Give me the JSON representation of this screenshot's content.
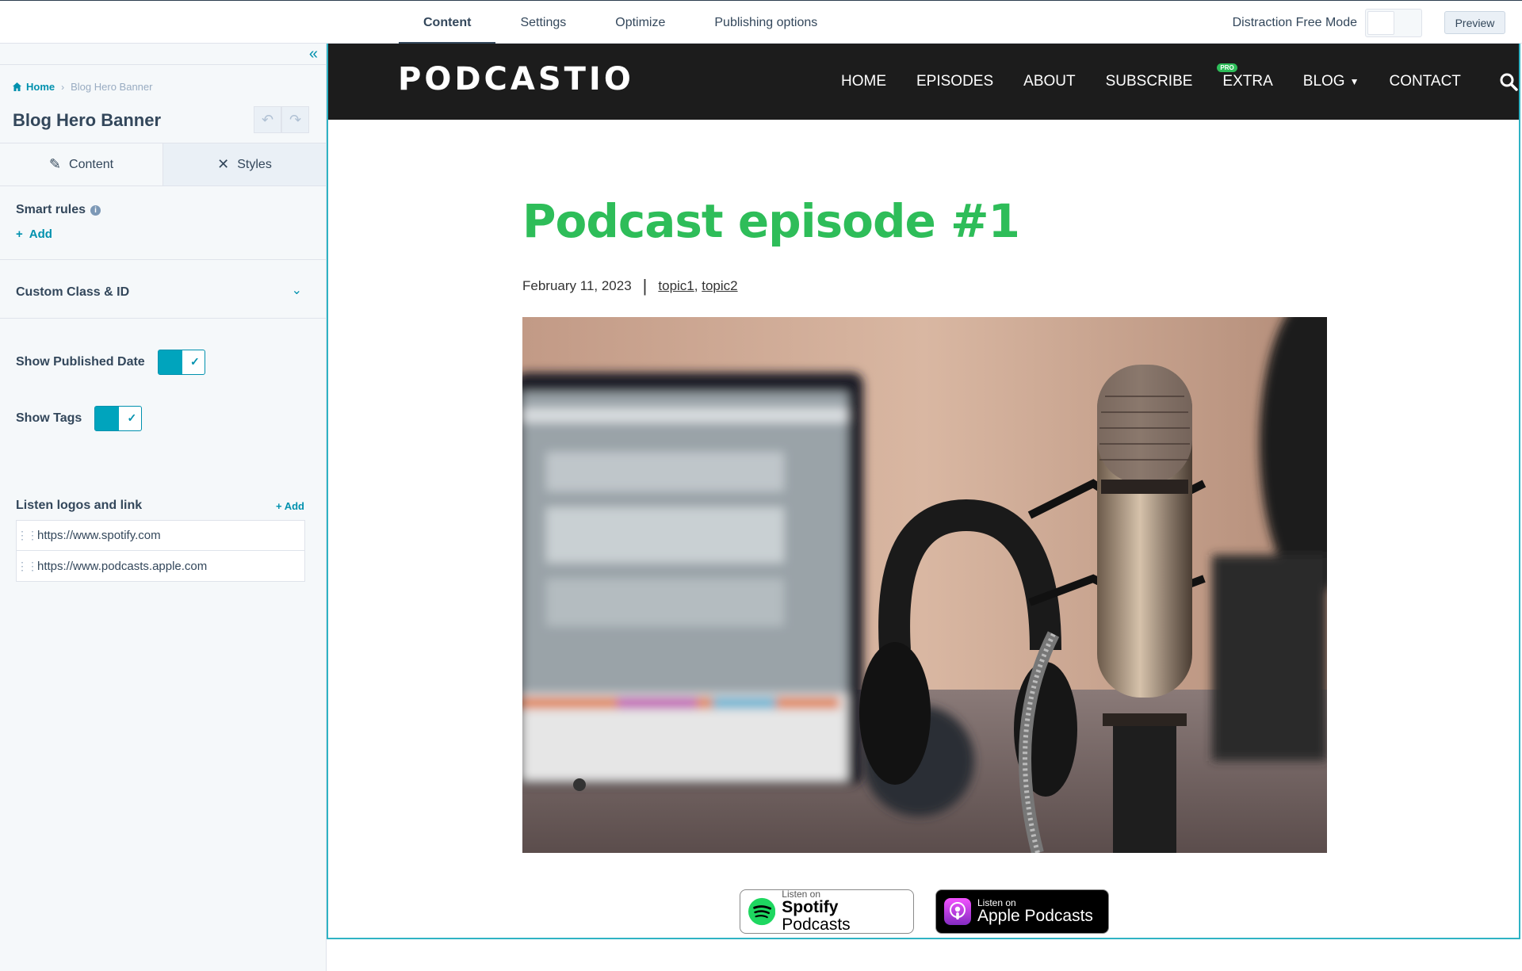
{
  "topbar": {
    "tabs": [
      {
        "label": "Content",
        "active": true
      },
      {
        "label": "Settings",
        "active": false
      },
      {
        "label": "Optimize",
        "active": false
      },
      {
        "label": "Publishing options",
        "active": false
      }
    ],
    "distraction_free_label": "Distraction Free Mode",
    "preview_label": "Preview"
  },
  "panel": {
    "breadcrumb": {
      "home": "Home",
      "current": "Blog Hero Banner"
    },
    "module_title": "Blog Hero Banner",
    "tabs": {
      "content": "Content",
      "styles": "Styles"
    },
    "smart_rules": {
      "label": "Smart rules",
      "add": "Add"
    },
    "custom_class": {
      "label": "Custom Class & ID"
    },
    "show_published_date": {
      "label": "Show Published Date",
      "checked": true
    },
    "show_tags": {
      "label": "Show Tags",
      "checked": true
    },
    "listen_logos": {
      "label": "Listen logos and link",
      "add": "+ Add",
      "urls": [
        "https://www.spotify.com",
        "https://www.podcasts.apple.com"
      ]
    }
  },
  "site": {
    "logo": "PODCASTIO",
    "nav": [
      "HOME",
      "EPISODES",
      "ABOUT",
      "SUBSCRIBE",
      "EXTRA",
      "BLOG",
      "CONTACT"
    ],
    "pro_badge": "PRO",
    "post_title": "Podcast episode #1",
    "date": "February 11, 2023",
    "tags": [
      "topic1",
      "topic2"
    ],
    "badges": {
      "spotify": {
        "small": "Listen on",
        "big_bold": "Spotify",
        "big_rest": " Podcasts"
      },
      "apple": {
        "small": "Listen on",
        "big": "Apple Podcasts"
      }
    }
  },
  "colors": {
    "accent": "#0091ae",
    "title_green": "#2ebd59",
    "nav_bg": "#1c1c1c",
    "frame_border": "#2fb3c4"
  }
}
